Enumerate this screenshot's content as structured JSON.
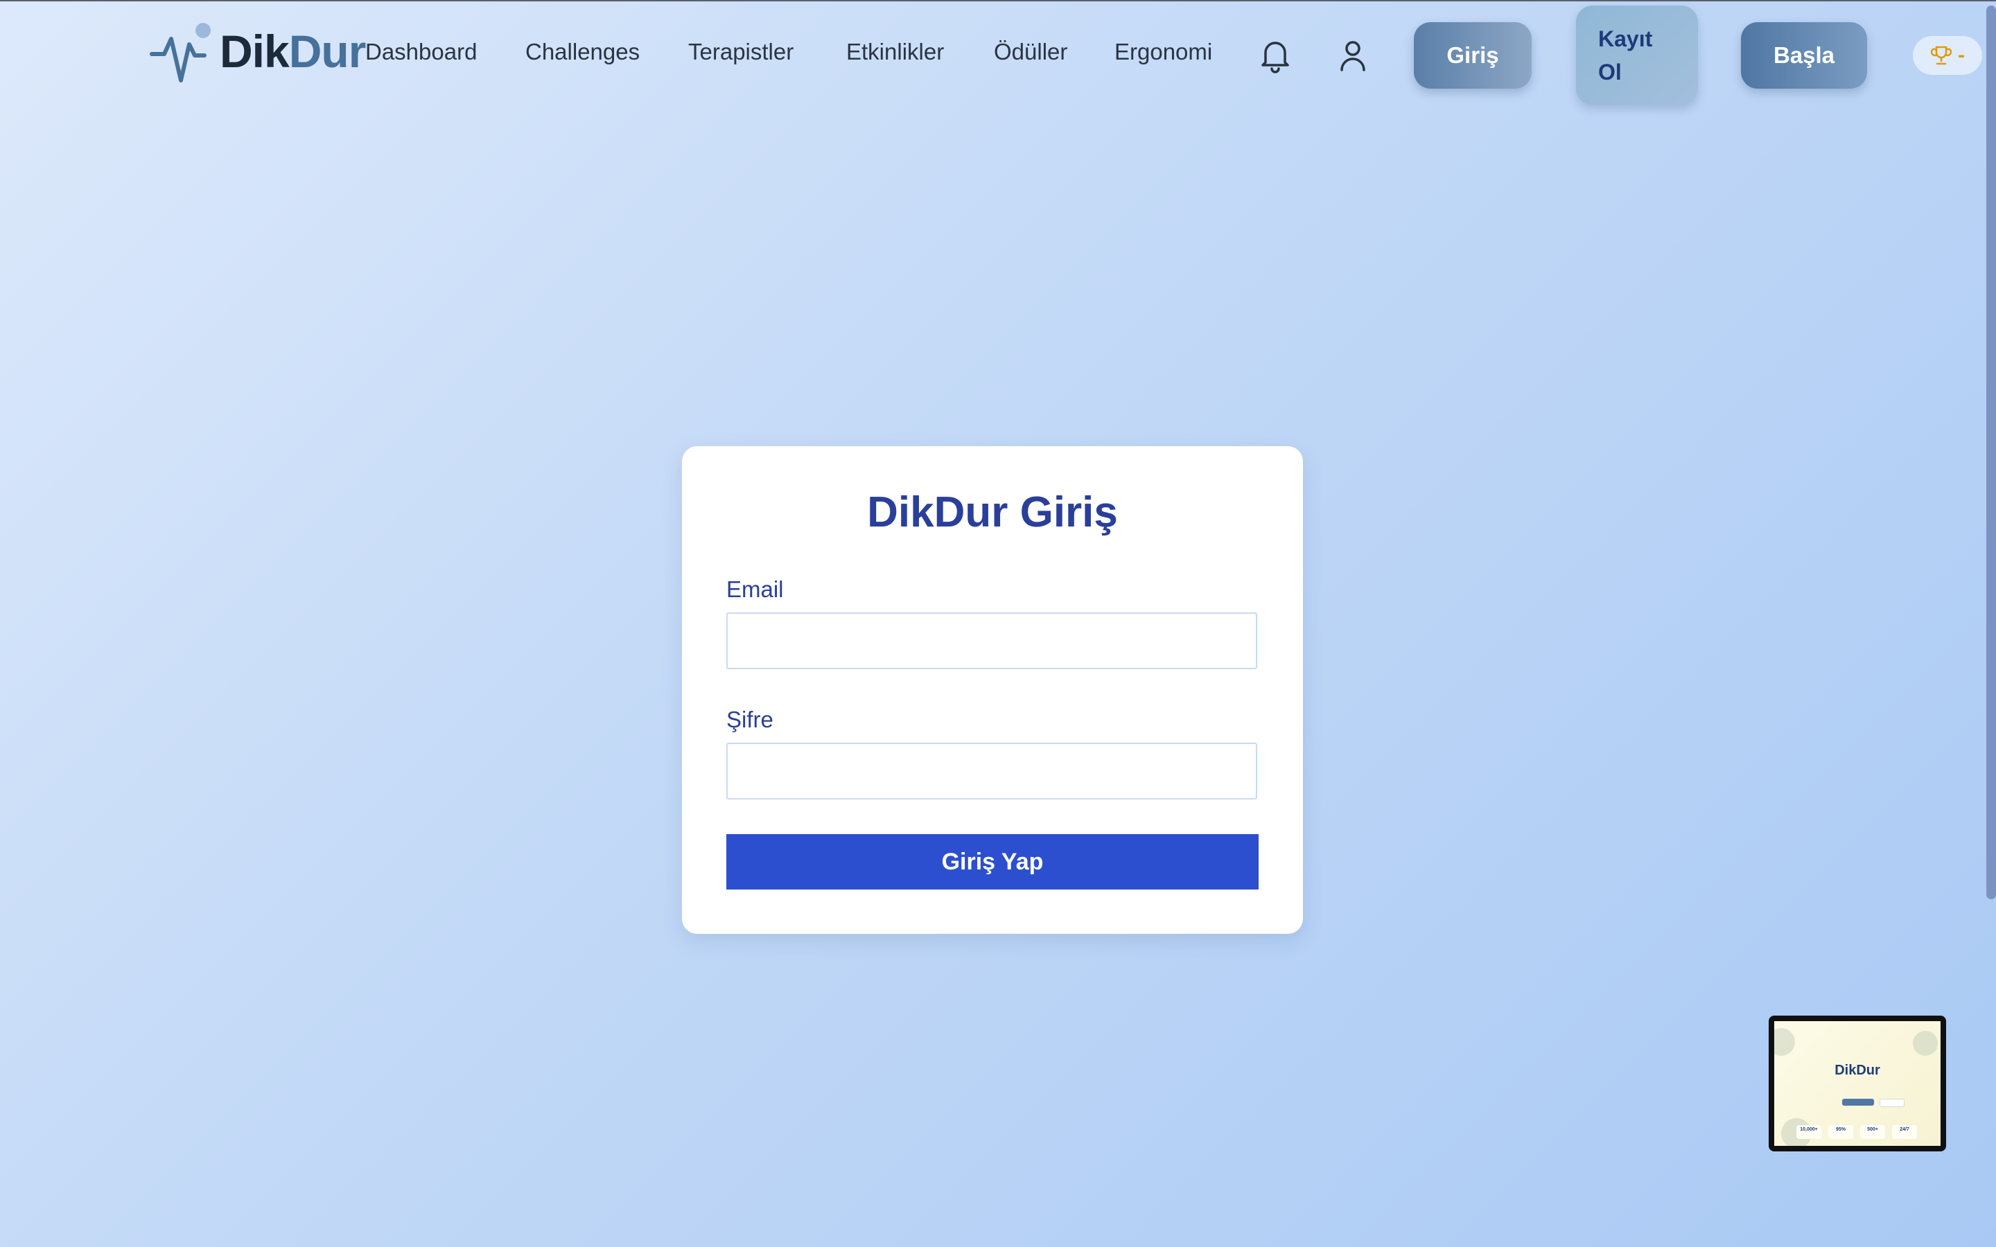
{
  "logo": {
    "part1": "Dik",
    "part2": "Dur"
  },
  "nav": {
    "links": [
      "Dashboard",
      "Challenges",
      "Terapistler",
      "Etkinlikler",
      "Ödüller",
      "Ergonomi"
    ],
    "notifications_icon": "bell-icon",
    "profile_icon": "user-icon"
  },
  "header_buttons": {
    "login": "Giriş",
    "register": "Kayıt Ol",
    "start": "Başla"
  },
  "trophy": {
    "icon": "trophy-icon",
    "value": "-"
  },
  "login_card": {
    "title": "DikDur Giriş",
    "email_label": "Email",
    "email_value": "",
    "password_label": "Şifre",
    "password_value": "",
    "submit_label": "Giriş Yap"
  },
  "preview_thumbnail": {
    "title": "DikDur",
    "stats": [
      "10,000+",
      "95%",
      "500+",
      "24/7"
    ]
  },
  "colors": {
    "primary": "#2c4fd0",
    "title_blue": "#2a3f9a",
    "brand_dark": "#1c2a3a",
    "brand_light": "#46719a"
  }
}
